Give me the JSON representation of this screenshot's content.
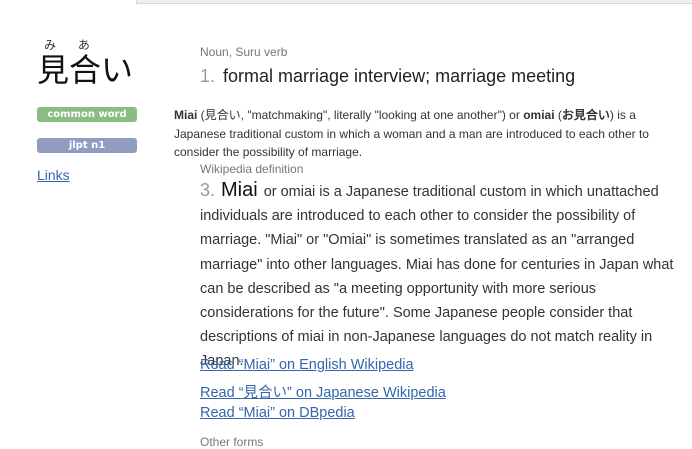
{
  "entry": {
    "furigana": "み あ",
    "word": "見合い",
    "tags": [
      "common word",
      "jlpt n1"
    ],
    "links_label": "Links"
  },
  "definitions": {
    "pos1": "Noun, Suru verb",
    "sense1_number": "1.",
    "sense1_meaning": "formal marriage interview; marriage meeting",
    "note": {
      "t1": "Miai",
      "t2": " (見合い, \"matchmaking\", literally \"looking at one another\") or ",
      "t3": "omiai",
      "t4": " (",
      "t5": "お見合い",
      "t6": ") is a Japanese traditional custom in which a woman and a man are introduced to each other to consider the possibility of marriage."
    },
    "pos2": "Wikipedia definition",
    "sense3_number": "3.",
    "sense3_word": "Miai",
    "sense3_text": "or omiai is a Japanese traditional custom in which unattached individuals are introduced to each other to consider the possibility of marriage. \"Miai\" or \"Omiai\" is sometimes translated as an \"arranged marriage\" into other languages. Miai has done for centuries in Japan what can be described as \"a meeting opportunity with more serious considerations for the future\". Some Japanese people consider that descriptions of miai in non-Japanese languages do not match reality in Japan.",
    "wiki_links": [
      "Read “Miai” on English Wikipedia",
      "Read “見合い” on Japanese Wikipedia",
      "Read “Miai” on DBpedia"
    ],
    "other_forms_label": "Other forms"
  }
}
